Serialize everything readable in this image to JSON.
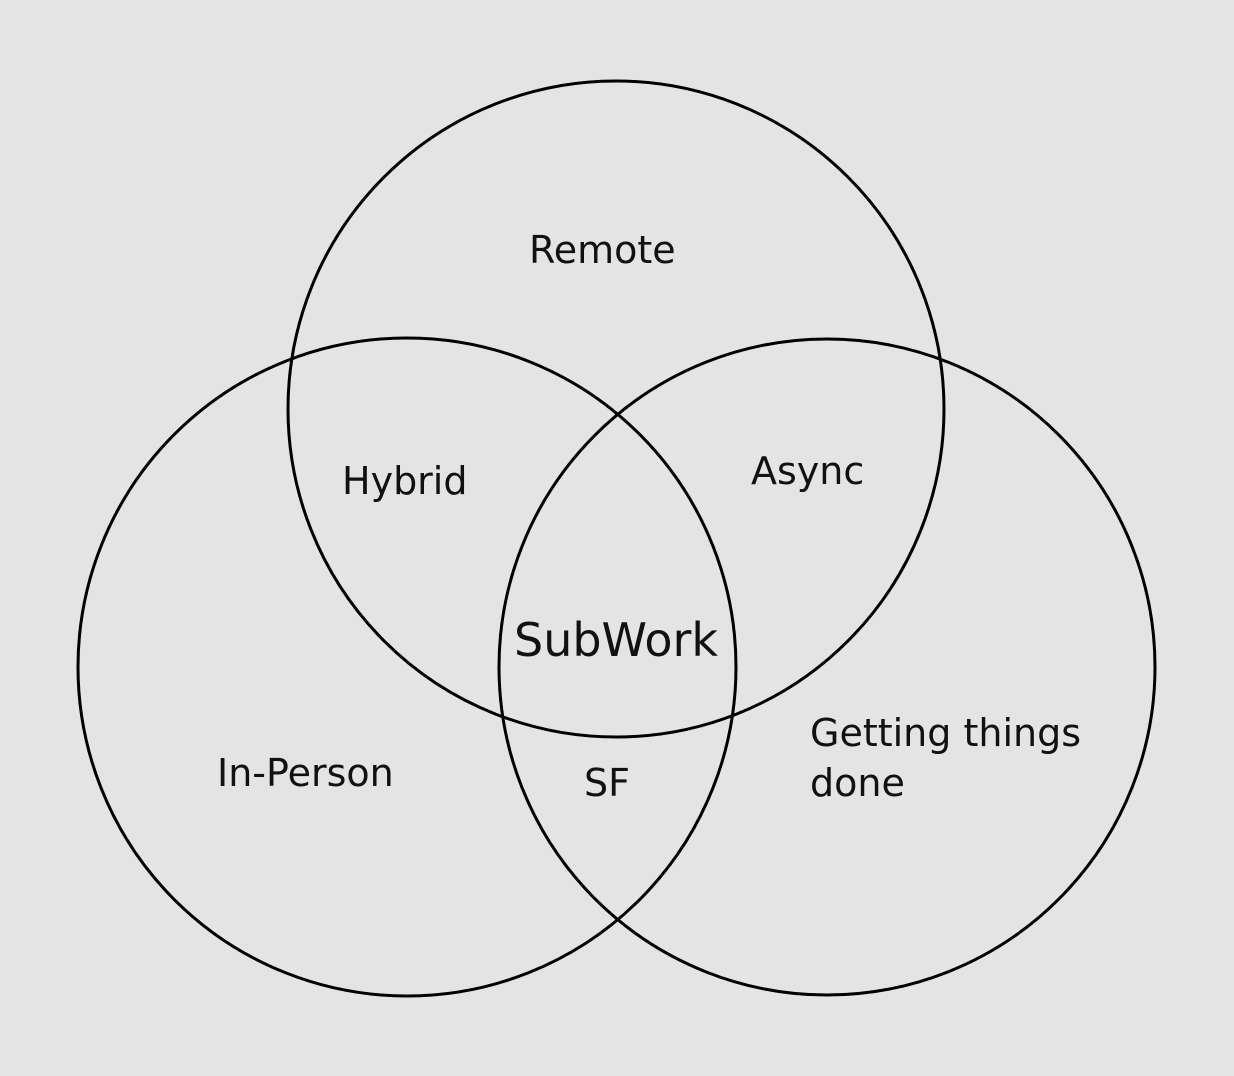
{
  "diagram": {
    "type": "venn-3",
    "sets": [
      {
        "id": "top",
        "label": "Remote"
      },
      {
        "id": "left",
        "label": "In-Person"
      },
      {
        "id": "right",
        "label_lines": [
          "Getting things",
          "done"
        ]
      }
    ],
    "intersections": {
      "top_left": "Hybrid",
      "top_right": "Async",
      "left_right": "SF",
      "center": "SubWork"
    }
  },
  "colors": {
    "background": "#e4e4e4",
    "stroke": "#000000",
    "text": "#111111"
  }
}
